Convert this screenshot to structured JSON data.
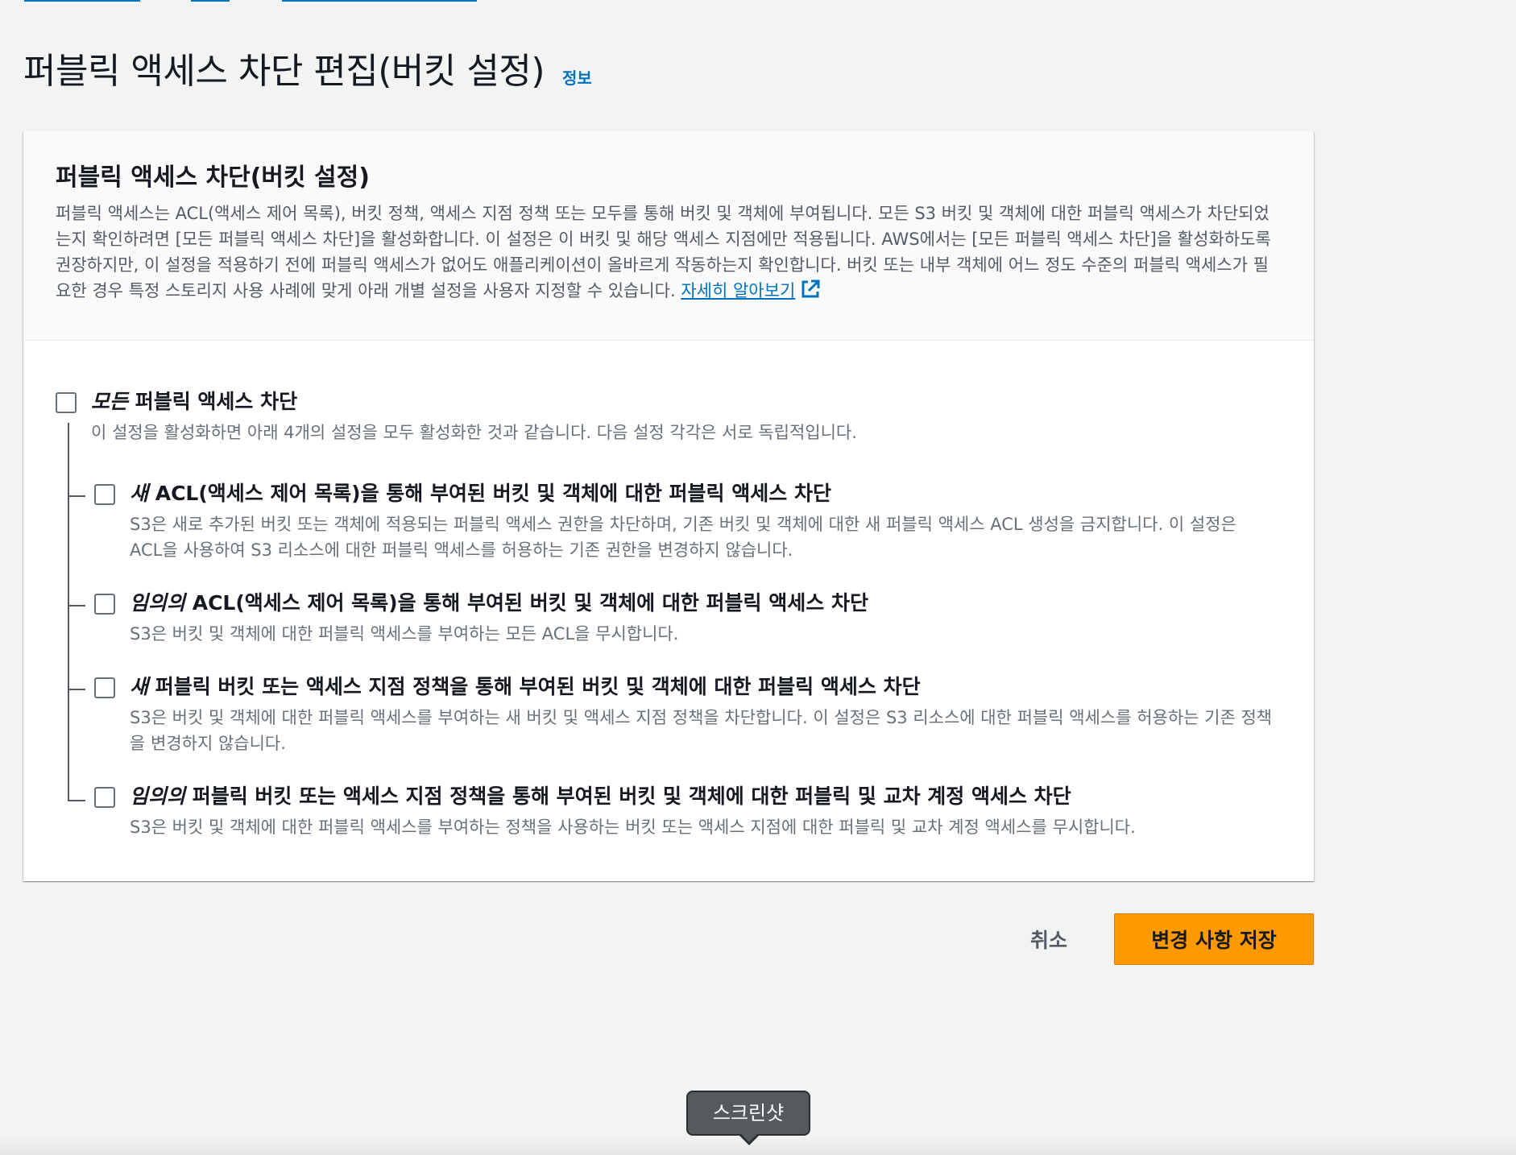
{
  "page": {
    "title": "퍼블릭 액세스 차단 편집(버킷 설정)",
    "info_link": "정보"
  },
  "container": {
    "title": "퍼블릭 액세스 차단(버킷 설정)",
    "description": "퍼블릭 액세스는 ACL(액세스 제어 목록), 버킷 정책, 액세스 지점 정책 또는 모두를 통해 버킷 및 객체에 부여됩니다. 모든 S3 버킷 및 객체에 대한 퍼블릭 액세스가 차단되었는지 확인하려면 [모든 퍼블릭 액세스 차단]을 활성화합니다. 이 설정은 이 버킷 및 해당 액세스 지점에만 적용됩니다. AWS에서는 [모든 퍼블릭 액세스 차단]을 활성화하도록 권장하지만, 이 설정을 적용하기 전에 퍼블릭 액세스가 없어도 애플리케이션이 올바르게 작동하는지 확인합니다. 버킷 또는 내부 객체에 어느 정도 수준의 퍼블릭 액세스가 필요한 경우 특정 스토리지 사용 사례에 맞게 아래 개별 설정을 사용자 지정할 수 있습니다.",
    "learn_more": "자세히 알아보기"
  },
  "settings": {
    "master": {
      "label_em": "모든",
      "label_rest": " 퍼블릭 액세스 차단",
      "description": "이 설정을 활성화하면 아래 4개의 설정을 모두 활성화한 것과 같습니다. 다음 설정 각각은 서로 독립적입니다.",
      "checked": false
    },
    "items": [
      {
        "label_em": "새",
        "label_rest": " ACL(액세스 제어 목록)을 통해 부여된 버킷 및 객체에 대한 퍼블릭 액세스 차단",
        "description": "S3은 새로 추가된 버킷 또는 객체에 적용되는 퍼블릭 액세스 권한을 차단하며, 기존 버킷 및 객체에 대한 새 퍼블릭 액세스 ACL 생성을 금지합니다. 이 설정은 ACL을 사용하여 S3 리소스에 대한 퍼블릭 액세스를 허용하는 기존 권한을 변경하지 않습니다.",
        "checked": false
      },
      {
        "label_em": "임의의",
        "label_rest": " ACL(액세스 제어 목록)을 통해 부여된 버킷 및 객체에 대한 퍼블릭 액세스 차단",
        "description": "S3은 버킷 및 객체에 대한 퍼블릭 액세스를 부여하는 모든 ACL을 무시합니다.",
        "checked": false
      },
      {
        "label_em": "새",
        "label_rest": " 퍼블릭 버킷 또는 액세스 지점 정책을 통해 부여된 버킷 및 객체에 대한 퍼블릭 액세스 차단",
        "description": "S3은 버킷 및 객체에 대한 퍼블릭 액세스를 부여하는 새 버킷 및 액세스 지점 정책을 차단합니다. 이 설정은 S3 리소스에 대한 퍼블릭 액세스를 허용하는 기존 정책을 변경하지 않습니다.",
        "checked": false
      },
      {
        "label_em": "임의의",
        "label_rest": " 퍼블릭 버킷 또는 액세스 지점 정책을 통해 부여된 버킷 및 객체에 대한 퍼블릭 및 교차 계정 액세스 차단",
        "description": "S3은 버킷 및 객체에 대한 퍼블릭 액세스를 부여하는 정책을 사용하는 버킷 또는 액세스 지점에 대한 퍼블릭 및 교차 계정 액세스를 무시합니다.",
        "checked": false
      }
    ]
  },
  "actions": {
    "cancel": "취소",
    "save": "변경 사항 저장"
  },
  "tooltip": {
    "text": "스크린샷"
  },
  "colors": {
    "primary_button": "#ff9900",
    "link": "#0073bb",
    "background": "#f2f3f3"
  }
}
